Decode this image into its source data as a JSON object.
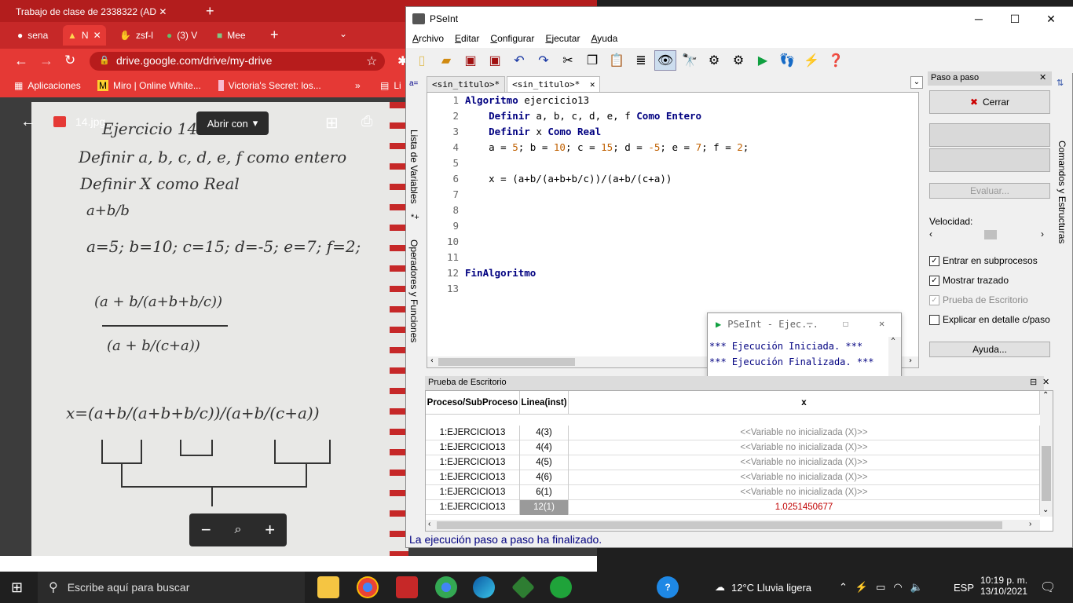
{
  "chrome": {
    "top_tab_label": "Trabajo de clase de 2338322 (AD",
    "tabs": [
      "sena",
      "N",
      "zsf-l",
      "(3) V",
      "Mee"
    ],
    "url": "drive.google.com/drive/my-drive",
    "bookmarks": [
      "Aplicaciones",
      "Miro | Online White...",
      "Victoria's Secret: los...",
      "Li"
    ],
    "viewer_file": "14.jpg",
    "open_with_label": "Abrir con",
    "notebook_lines": [
      "Ejercicio 14",
      "Definir a, b, c, d, e, f como entero",
      "Definir X como Real",
      "a=5; b=10; c=15; d=-5; e=7; f=2;",
      "x=(a+b/(a+b+b/c))/(a+b/(c+a))"
    ]
  },
  "pseint": {
    "title": "PSeInt",
    "menu": [
      "Archivo",
      "Editar",
      "Configurar",
      "Ejecutar",
      "Ayuda"
    ],
    "side_left_1": "Lista de Variables",
    "side_left_2": "Operadores y Funciones",
    "side_right": "Comandos y Estructuras",
    "tabs": [
      "<sin_titulo>*",
      "<sin_titulo>*"
    ],
    "code_lines": [
      {
        "n": "1",
        "text": ""
      },
      {
        "n": "2",
        "text": ""
      },
      {
        "n": "3",
        "text": ""
      },
      {
        "n": "4",
        "text": ""
      },
      {
        "n": "5",
        "text": ""
      },
      {
        "n": "6",
        "text": "    x = (a+b/(a+b+b/c))/(a+b/(c+a))"
      },
      {
        "n": "7",
        "text": ""
      },
      {
        "n": "8",
        "text": ""
      },
      {
        "n": "9",
        "text": ""
      },
      {
        "n": "10",
        "text": ""
      },
      {
        "n": "11",
        "text": ""
      },
      {
        "n": "12",
        "text": ""
      },
      {
        "n": "13",
        "text": ""
      }
    ],
    "code": {
      "l1_kw": "Algoritmo",
      "l1_rest": " ejercicio13",
      "l2_kw": "Definir",
      "l2_mid": " a, b, c, d, e, f ",
      "l2_kw2": "Como Entero",
      "l3_kw": "Definir",
      "l3_mid": " x ",
      "l3_kw2": "Como Real",
      "l4_a": "a = ",
      "l4_av": "5",
      "l4_b": "; b = ",
      "l4_bv": "10",
      "l4_c": "; c = ",
      "l4_cv": "15",
      "l4_d": "; d = ",
      "l4_dv": "-5",
      "l4_e": "; e = ",
      "l4_ev": "7",
      "l4_f": "; f = ",
      "l4_fv": "2",
      "l4_end": ";",
      "l12_kw": "FinAlgoritmo"
    },
    "paso": {
      "header": "Paso a paso",
      "cerrar": "Cerrar",
      "evaluar": "Evaluar...",
      "velocidad": "Velocidad:",
      "velocidad_level": 0.5,
      "subprocesos": "Entrar en subprocesos",
      "trazado": "Mostrar trazado",
      "prueba": "Prueba de Escritorio",
      "explicar": "Explicar en detalle c/paso",
      "ayuda": "Ayuda..."
    },
    "popup": {
      "title": "PSeInt - Ejec...",
      "line1": "*** Ejecución Iniciada. ***",
      "line2": "*** Ejecución Finalizada. ***"
    },
    "prueba": {
      "header": "Prueba de Escritorio",
      "columns": [
        "Proceso/SubProceso",
        "Linea(inst)",
        "x"
      ],
      "rows": [
        {
          "proc": "1:EJERCICIO13",
          "line": "4(3)",
          "x": "<<Variable no inicializada (X)>>"
        },
        {
          "proc": "1:EJERCICIO13",
          "line": "4(4)",
          "x": "<<Variable no inicializada (X)>>"
        },
        {
          "proc": "1:EJERCICIO13",
          "line": "4(5)",
          "x": "<<Variable no inicializada (X)>>"
        },
        {
          "proc": "1:EJERCICIO13",
          "line": "4(6)",
          "x": "<<Variable no inicializada (X)>>"
        },
        {
          "proc": "1:EJERCICIO13",
          "line": "6(1)",
          "x": "<<Variable no inicializada (X)>>"
        },
        {
          "proc": "1:EJERCICIO13",
          "line": "12(1)",
          "x": "1.0251450677"
        }
      ]
    },
    "status": "La ejecución paso a paso ha finalizado."
  },
  "taskbar": {
    "search_placeholder": "Escribe aquí para buscar",
    "weather": "12°C  Lluvia ligera",
    "lang": "ESP",
    "time": "10:19 p. m.",
    "date": "13/10/2021"
  }
}
